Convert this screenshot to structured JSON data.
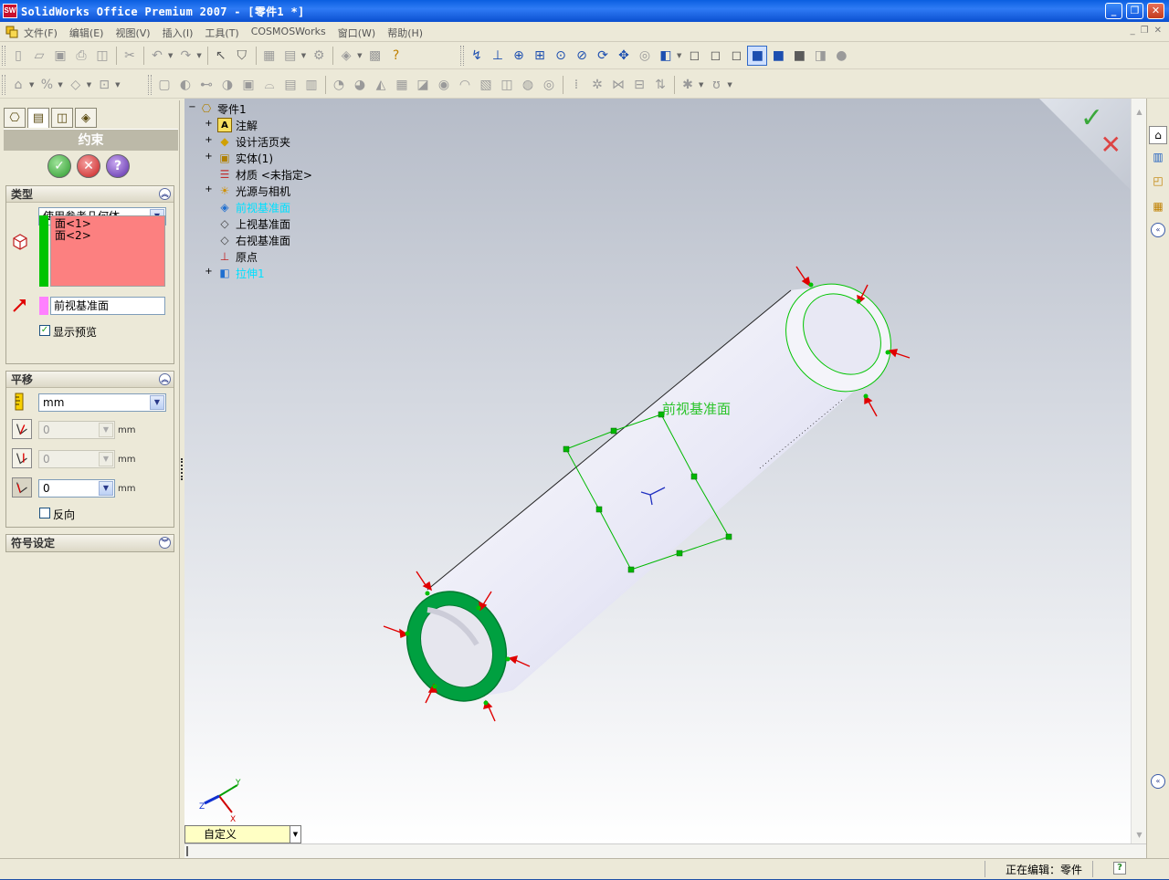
{
  "window": {
    "title": "SolidWorks Office Premium 2007 - [零件1 *]",
    "logo_text": "SW",
    "minimize": "_",
    "maximize": "❐",
    "close": "✕"
  },
  "menu": {
    "items": [
      "文件(F)",
      "编辑(E)",
      "视图(V)",
      "插入(I)",
      "工具(T)",
      "COSMOSWorks",
      "窗口(W)",
      "帮助(H)"
    ],
    "mdi_buttons": [
      "_",
      "❐",
      "✕"
    ]
  },
  "property_manager": {
    "title": "约束",
    "ok_label": "✓",
    "cancel_label": "✕",
    "help_label": "?",
    "type_group": {
      "header": "类型",
      "method": "使用参考几何体",
      "faces": [
        "面<1>",
        "面<2>"
      ],
      "plane": "前视基准面",
      "show_preview_label": "显示预览",
      "show_preview_checked": "✓"
    },
    "translation_group": {
      "header": "平移",
      "units": "mm",
      "value1": "0",
      "value2": "0",
      "value3": "0",
      "unit_label": "mm",
      "reverse_label": "反向"
    },
    "symbol_group": {
      "header": "符号设定"
    }
  },
  "feature_tree": {
    "root": "零件1",
    "items": [
      {
        "label": "注解",
        "icon": "annotation-icon",
        "expandable": true,
        "highlight": false
      },
      {
        "label": "设计活页夹",
        "icon": "binder-icon",
        "expandable": true,
        "highlight": false
      },
      {
        "label": "实体(1)",
        "icon": "solid-bodies-icon",
        "expandable": true,
        "highlight": false
      },
      {
        "label": "材质 <未指定>",
        "icon": "material-icon",
        "expandable": false,
        "highlight": false
      },
      {
        "label": "光源与相机",
        "icon": "lights-cameras-icon",
        "expandable": true,
        "highlight": false
      },
      {
        "label": "前视基准面",
        "icon": "plane-icon",
        "expandable": false,
        "highlight": true
      },
      {
        "label": "上视基准面",
        "icon": "plane-icon",
        "expandable": false,
        "highlight": false
      },
      {
        "label": "右视基准面",
        "icon": "plane-icon",
        "expandable": false,
        "highlight": false
      },
      {
        "label": "原点",
        "icon": "origin-icon",
        "expandable": false,
        "highlight": false
      },
      {
        "label": "拉伸1",
        "icon": "extrude-icon",
        "expandable": true,
        "highlight": true
      }
    ]
  },
  "viewport": {
    "plane_label": "前视基准面",
    "view_orientation": "自定义",
    "triad": {
      "x": "X",
      "y": "Y",
      "z": "Z"
    },
    "colors": {
      "selected_face": "#00a040",
      "preview": "#00c400",
      "arrow": "#e00000"
    }
  },
  "status": {
    "editing": "正在编辑：零件",
    "help": "?"
  }
}
